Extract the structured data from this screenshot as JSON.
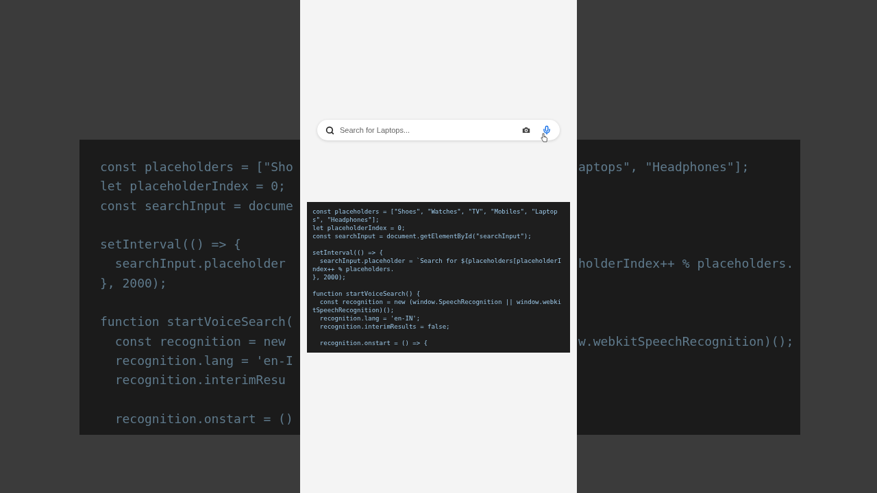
{
  "background_code": [
    {
      "rows": [
        {
          "left": "const placeholders = [\"Sho",
          "right": "aptops\", \"Headphones\"];"
        },
        {
          "left": "let placeholderIndex = 0;"
        },
        {
          "left": "const searchInput = docume"
        }
      ]
    },
    {
      "rows": [
        {
          "left": "setInterval(() => {"
        },
        {
          "left": "  searchInput.placeholder",
          "right": "holderIndex++ % placeholders."
        },
        {
          "left": "}, 2000);"
        }
      ]
    },
    {
      "rows": [
        {
          "left": "function startVoiceSearch("
        },
        {
          "left": "  const recognition = new",
          "right": "w.webkitSpeechRecognition)();"
        },
        {
          "left": "  recognition.lang = 'en-I"
        },
        {
          "left": "  recognition.interimResu"
        }
      ]
    },
    {
      "rows": [
        {
          "left": "  recognition.onstart = ()"
        }
      ]
    }
  ],
  "search": {
    "placeholder": "Search for Laptops..."
  },
  "code_snippet": [
    {
      "lines": [
        "const placeholders = [\"Shoes\", \"Watches\", \"TV\", \"Mobiles\", \"Laptops\", \"Headphones\"];",
        "let placeholderIndex = 0;",
        "const searchInput = document.getElementById(\"searchInput\");"
      ]
    },
    {
      "lines": [
        "setInterval(() => {",
        "  searchInput.placeholder = `Search for ${placeholders[placeholderIndex++ % placeholders.",
        "}, 2000);"
      ]
    },
    {
      "lines": [
        "function startVoiceSearch() {",
        "  const recognition = new (window.SpeechRecognition || window.webkitSpeechRecognition)();",
        "  recognition.lang = 'en-IN';",
        "  recognition.interimResults = false;"
      ]
    },
    {
      "lines": [
        "  recognition.onstart = () => {"
      ]
    }
  ]
}
